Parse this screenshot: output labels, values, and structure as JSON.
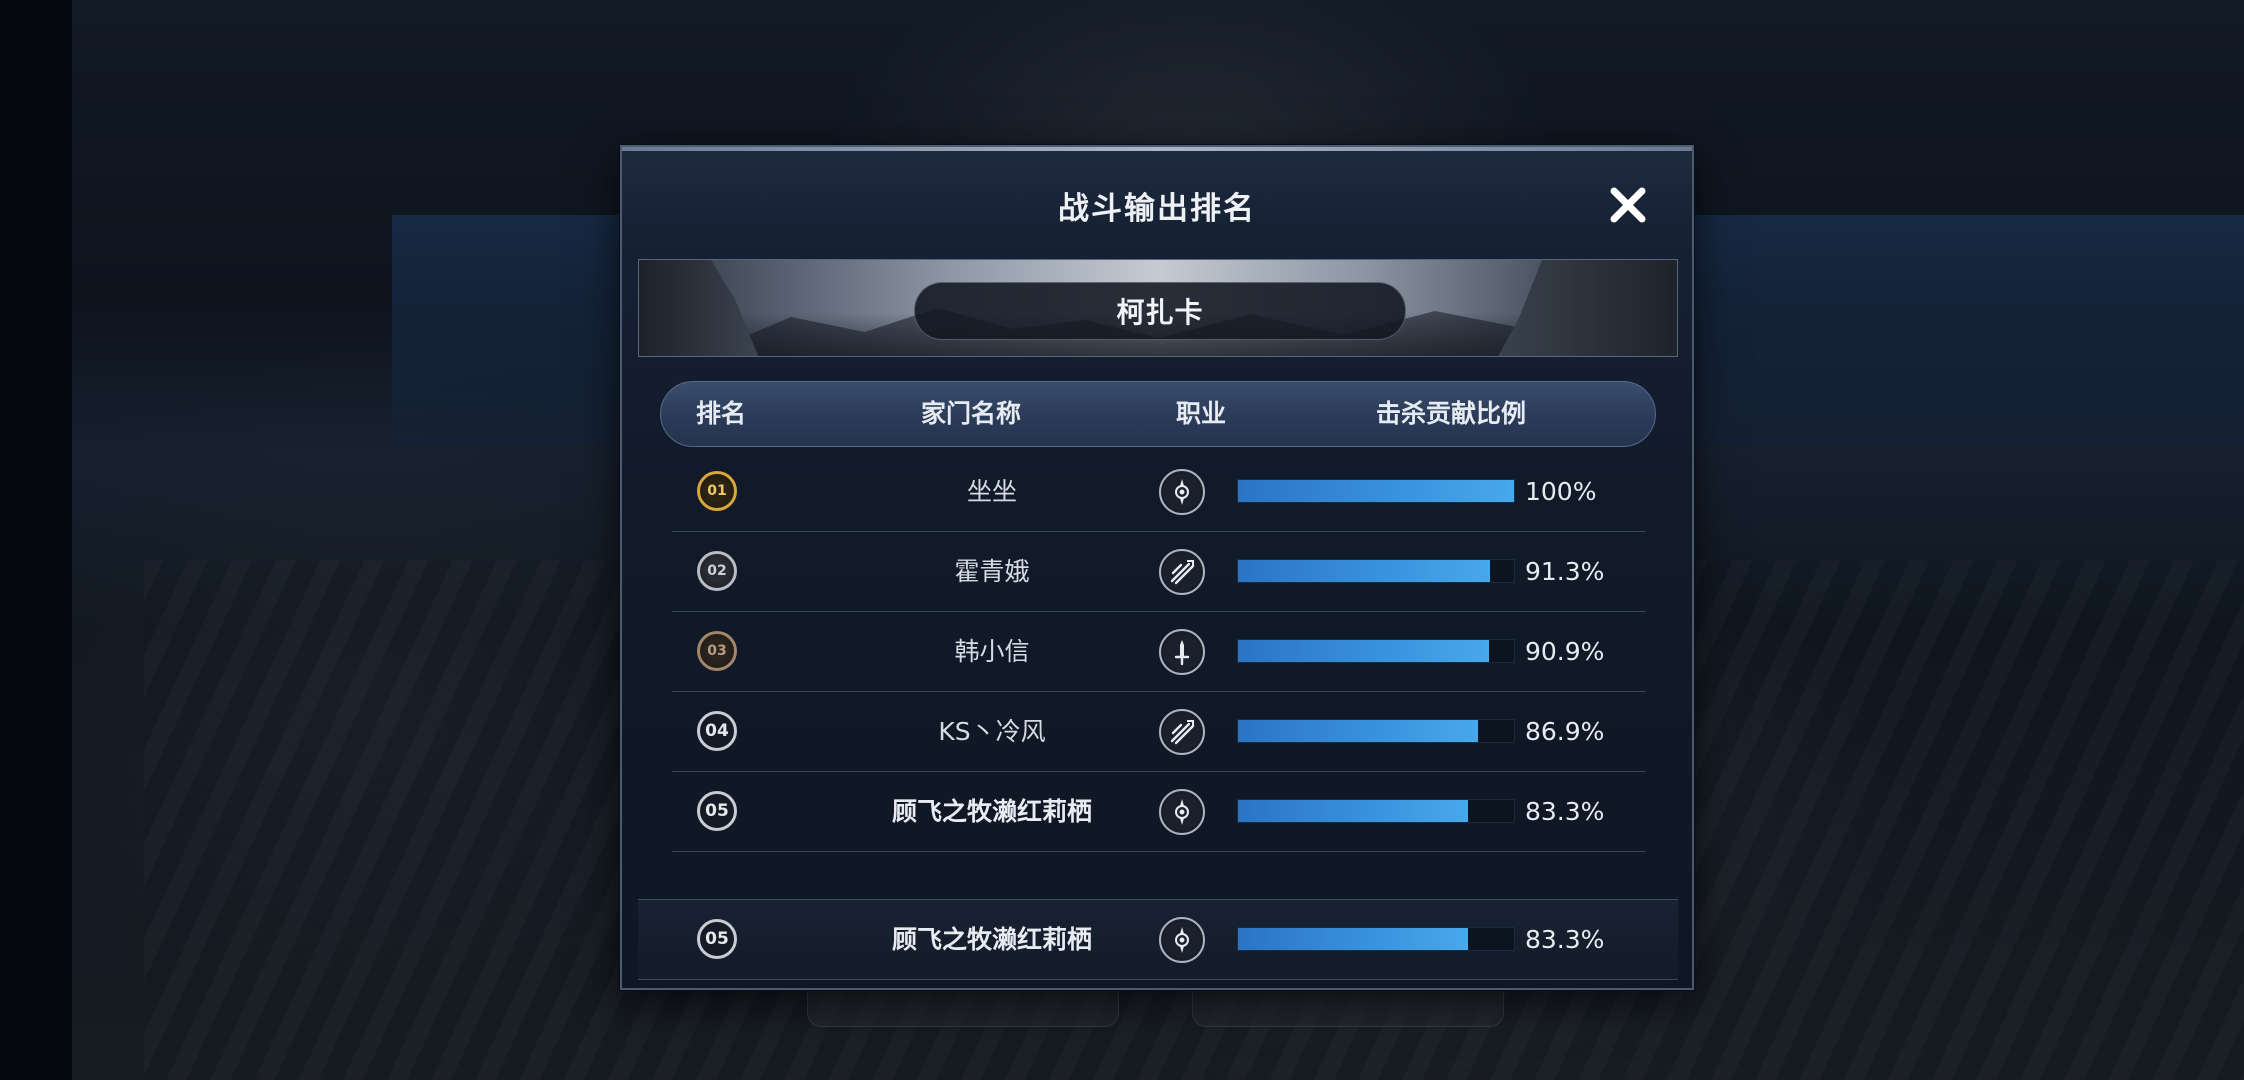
{
  "modal": {
    "title": "战斗输出排名",
    "close_icon": "close-icon",
    "boss_name": "柯扎卡"
  },
  "table": {
    "headers": {
      "rank": "排名",
      "family_name": "家门名称",
      "class": "职业",
      "kill_contribution": "击杀贡献比例"
    },
    "rows": [
      {
        "rank": "01",
        "rank_style": "gold",
        "name": "坐坐",
        "class_icon": "compass-class-icon",
        "ratio": 1.0,
        "pct": "100%",
        "name_bold": false
      },
      {
        "rank": "02",
        "rank_style": "silver",
        "name": "霍青娥",
        "class_icon": "slash-class-icon",
        "ratio": 0.913,
        "pct": "91.3%",
        "name_bold": false
      },
      {
        "rank": "03",
        "rank_style": "bronze",
        "name": "韩小信",
        "class_icon": "sword-class-icon",
        "ratio": 0.909,
        "pct": "90.9%",
        "name_bold": false
      },
      {
        "rank": "04",
        "rank_style": "plain",
        "name": "KS丶冷风",
        "class_icon": "slash-class-icon",
        "ratio": 0.869,
        "pct": "86.9%",
        "name_bold": false
      },
      {
        "rank": "05",
        "rank_style": "plain",
        "name": "顾飞之牧濑红莉栖",
        "class_icon": "compass-class-icon",
        "ratio": 0.833,
        "pct": "83.3%",
        "name_bold": true
      }
    ]
  },
  "self_row": {
    "rank": "05",
    "name": "顾飞之牧濑红莉栖",
    "class_icon": "compass-class-icon",
    "ratio": 0.833,
    "pct": "83.3%"
  },
  "colors": {
    "bar_fill": "#3a93dd",
    "gold": "#d8a63a",
    "panel": "#111a29"
  }
}
